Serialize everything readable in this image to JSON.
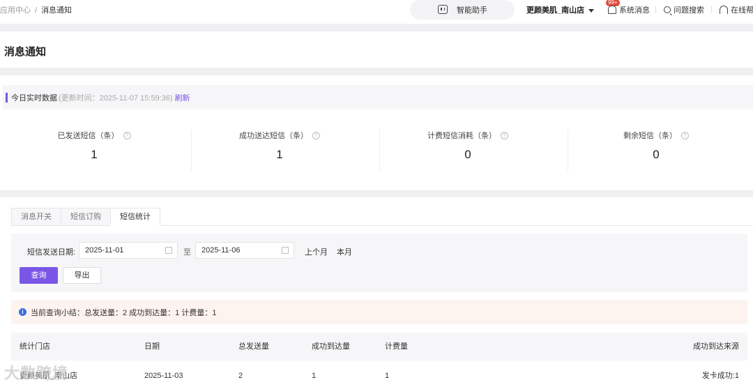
{
  "topbar": {
    "breadcrumb": [
      "应用中心",
      "消息通知"
    ],
    "breadcrumb_sep": "/",
    "assistant_label": "智能助手",
    "store_name": "更颜美肌_南山店",
    "notification_badge": "99+",
    "system_messages": "系统消息",
    "search_help": "问题搜索",
    "online_help": "在线帮"
  },
  "header": {
    "title": "消息通知"
  },
  "realtime": {
    "label": "今日实时数据",
    "updated": "(更新时间：2025-11-07 15:59:36)",
    "refresh": "刷新"
  },
  "stats": [
    {
      "label": "已发送短信（条）",
      "value": "1"
    },
    {
      "label": "成功送达短信（条）",
      "value": "1"
    },
    {
      "label": "计费短信消耗（条）",
      "value": "0"
    },
    {
      "label": "剩余短信（条）",
      "value": "0"
    }
  ],
  "tabs": [
    {
      "label": "消息开关"
    },
    {
      "label": "短信订购"
    },
    {
      "label": "短信统计"
    }
  ],
  "filter": {
    "date_label": "短信发送日期:",
    "start_date": "2025-11-01",
    "to": "至",
    "end_date": "2025-11-06",
    "last_month": "上个月",
    "this_month": "本月",
    "query_button": "查询",
    "export_button": "导出"
  },
  "summary": {
    "text": "当前查询小结：总发送量：2 成功到达量：1 计费量：1"
  },
  "table": {
    "headers": [
      "统计门店",
      "日期",
      "总发送量",
      "成功到达量",
      "计费量",
      "成功到达来源"
    ],
    "rows": [
      [
        "更颜美肌_南山店",
        "2025-11-03",
        "2",
        "1",
        "1",
        "发卡成功:1"
      ]
    ]
  },
  "watermark": "大数跨境",
  "colors": {
    "accent": "#7a56e6",
    "badge": "#e0463a",
    "info": "#3d6fe0"
  }
}
